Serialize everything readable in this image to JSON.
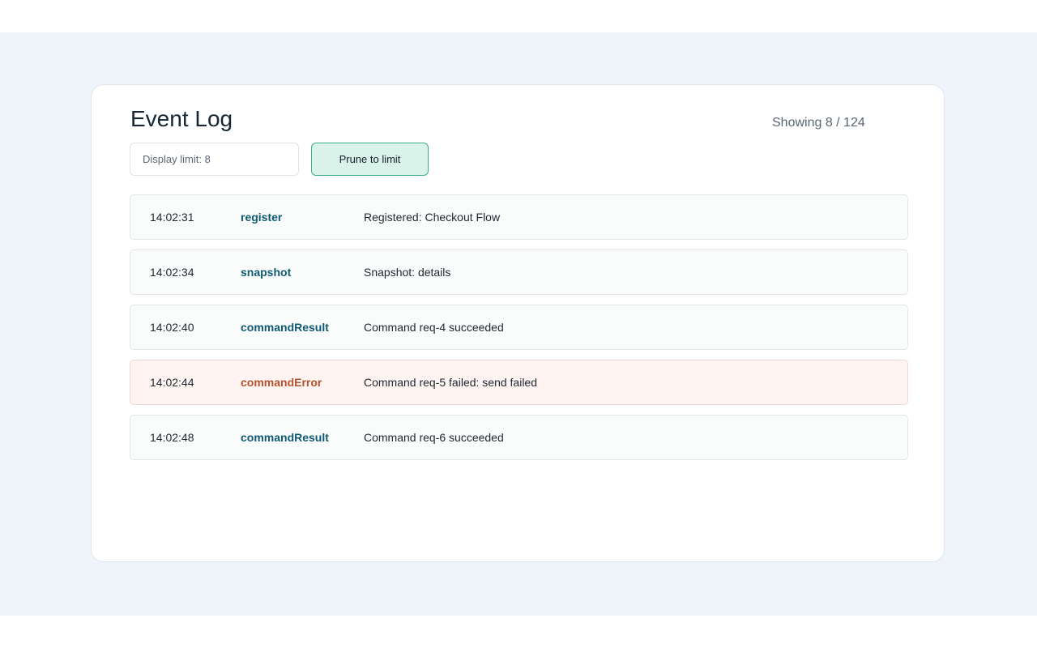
{
  "log": {
    "title": "Event Log",
    "count_text": "Showing 8 / 124",
    "limit_placeholder": "Display limit: 8",
    "prune_label": "Prune to limit"
  },
  "events": [
    {
      "time": "14:02:31",
      "type": "register",
      "message": "Registered: Checkout Flow",
      "status": "info"
    },
    {
      "time": "14:02:34",
      "type": "snapshot",
      "message": "Snapshot: details",
      "status": "info"
    },
    {
      "time": "14:02:40",
      "type": "commandResult",
      "message": "Command req-4 succeeded",
      "status": "info"
    },
    {
      "time": "14:02:44",
      "type": "commandError",
      "message": "Command req-5 failed: send failed",
      "status": "error"
    },
    {
      "time": "14:02:48",
      "type": "commandResult",
      "message": "Command req-6 succeeded",
      "status": "info"
    }
  ],
  "colors": {
    "page_background": "#eef4fa",
    "event_type": "#0f5a72",
    "error_type": "#b5512c",
    "error_row": "#fff4f1",
    "button_fill": "#d9f3ea",
    "button_border": "#3faf83"
  }
}
